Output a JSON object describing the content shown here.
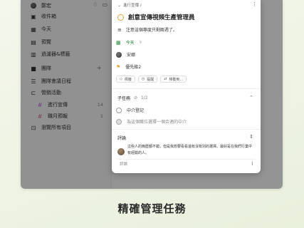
{
  "sidebar": {
    "user": "鄭宏",
    "items": [
      {
        "label": "收件箱",
        "count": "",
        "icon": "inbox-icon"
      },
      {
        "label": "今天",
        "count": "",
        "icon": "calendar-today-icon"
      },
      {
        "label": "預覽",
        "count": "",
        "icon": "calendar-icon"
      },
      {
        "label": "過濾器&標籤",
        "count": "",
        "icon": "filter-icon"
      }
    ],
    "workspace": {
      "label": "團隊",
      "add": "+"
    },
    "projects": [
      {
        "label": "團隊會議日程",
        "count": "",
        "icon": "list-icon"
      },
      {
        "label": "營銷活動",
        "count": "",
        "icon": "folder-icon"
      },
      {
        "label": "進行宣傳",
        "count": "14",
        "icon": "hash-icon"
      },
      {
        "label": "職月預報",
        "count": "1",
        "icon": "hash-icon"
      },
      {
        "label": "瀏覽所有項目",
        "count": "",
        "icon": "folder-search-icon"
      }
    ]
  },
  "dialog": {
    "breadcrumb": "進行宣傳 /",
    "task_title": "創意宣傳視頻生產管理員",
    "description": "注意這個專度只剩兩週了。",
    "due": "今天",
    "assignee": "安娜",
    "priority": "優先級2",
    "chips": [
      "標籤",
      "提醒",
      "移動到..."
    ],
    "subtasks_label": "子任務",
    "subtasks_count": "1/2",
    "subtasks": [
      {
        "text": "中介登記",
        "done": false
      },
      {
        "text": "為這個職位選擇一個合適的中介",
        "done": true
      }
    ],
    "comments_label": "評論",
    "comment": "這些人的簡歷都不錯，但是我想要看看還有沒有別的選擇。最好是在我們行業中有經驗的人。",
    "comment_placeholder": "評論"
  },
  "headline": "精確管理任務",
  "colors": {
    "accent": "#e8a33a",
    "today_green": "#1f8a3a",
    "priority_orange": "#e8a33a",
    "hash": "#b86ad8"
  }
}
